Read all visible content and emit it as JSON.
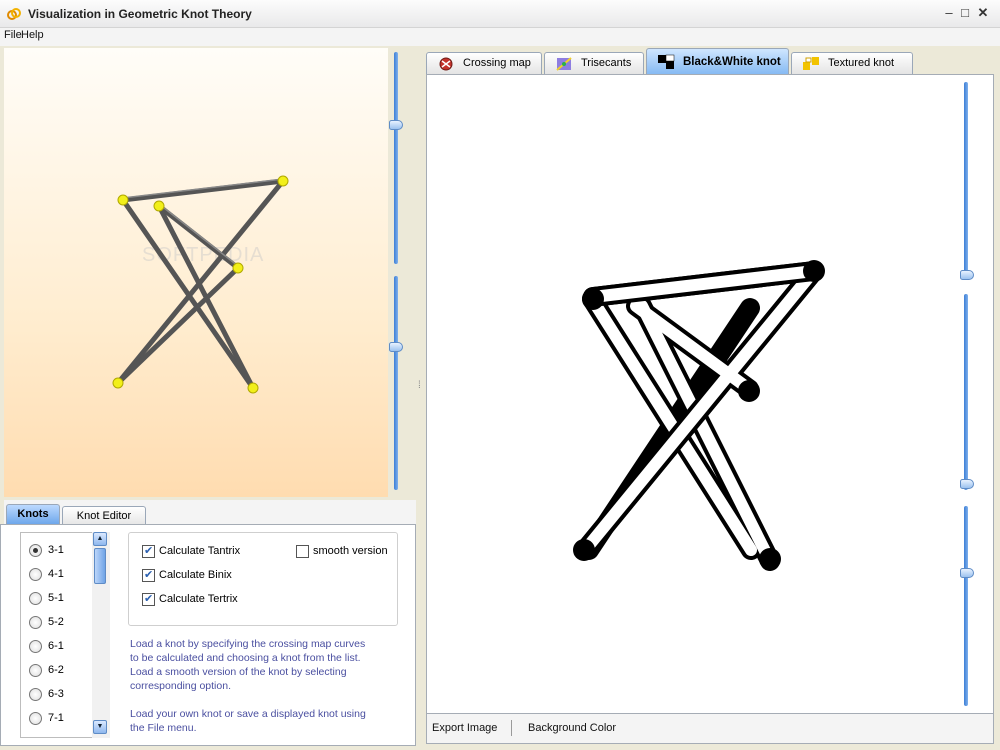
{
  "window": {
    "title": "Visualization in Geometric Knot Theory"
  },
  "menu": {
    "items": [
      "File",
      "Help"
    ]
  },
  "view3d": {
    "watermark": "SOFTPEDIA"
  },
  "left_tabs": [
    "Knots",
    "Knot Editor"
  ],
  "knots": {
    "items": [
      "3-1",
      "4-1",
      "5-1",
      "5-2",
      "6-1",
      "6-2",
      "6-3",
      "7-1"
    ],
    "selected": "3-1"
  },
  "options": {
    "tantrix": "Calculate Tantrix",
    "binix": "Calculate Binix",
    "tertrix": "Calculate Tertrix",
    "smooth": "smooth version"
  },
  "info": {
    "p1": "Load a knot by specifying the crossing map curves to be calculated and choosing a knot from the list. Load a smooth version of the knot by selecting corresponding option.",
    "p2": "Load your own knot or save a displayed knot using the File menu."
  },
  "right_tabs": [
    "Crossing map",
    "Trisecants",
    "Black&White knot",
    "Textured knot"
  ],
  "bottom": {
    "export": "Export Image",
    "background": "Background Color"
  },
  "colors": {
    "accent": "#3d7fd6",
    "vertex": "#f2ef1a",
    "knot": "#000000"
  }
}
